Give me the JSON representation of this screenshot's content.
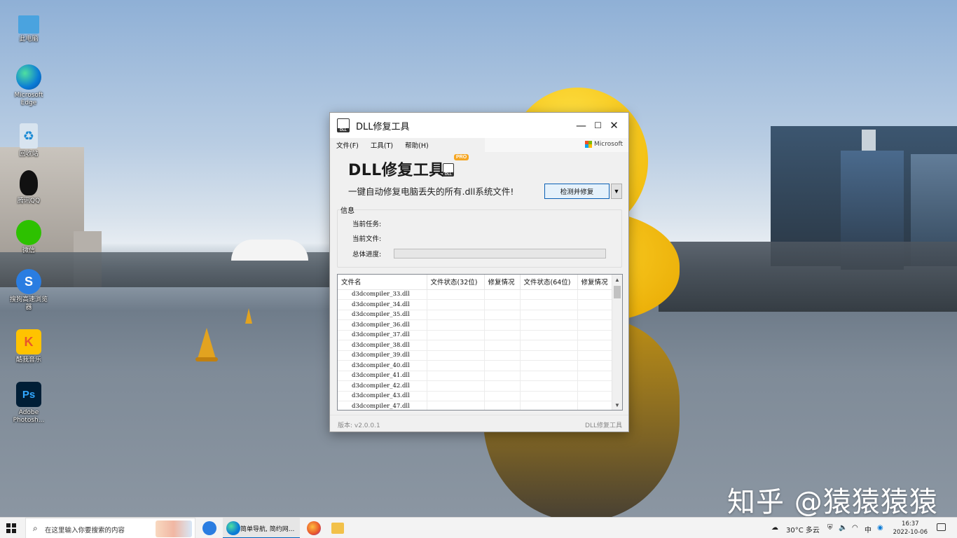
{
  "desktop": {
    "icons": [
      {
        "label": "此电脑",
        "icon": "computer-icon",
        "color": "#4aa3df"
      },
      {
        "label": "Microsoft Edge",
        "icon": "edge-icon",
        "color": "#0a7bd6"
      },
      {
        "label": "回收站",
        "icon": "recycle-bin-icon",
        "color": "#d8e4ef"
      },
      {
        "label": "腾讯QQ",
        "icon": "qq-icon",
        "color": "#111111"
      },
      {
        "label": "微信",
        "icon": "wechat-icon",
        "color": "#2dc100"
      },
      {
        "label": "搜狗高速浏览器",
        "icon": "sogou-browser-icon",
        "color": "#2a7de1"
      },
      {
        "label": "酷我音乐",
        "icon": "kuwo-music-icon",
        "color": "#ffc300"
      },
      {
        "label": "Adobe Photosh...",
        "icon": "photoshop-icon",
        "color": "#001e36"
      }
    ],
    "watermark": "知乎 @猿猿猿猿"
  },
  "window": {
    "title": "DLL修复工具",
    "controls": {
      "minimize": "—",
      "maximize": "☐",
      "close": "✕"
    },
    "menu": [
      "文件(F)",
      "工具(T)",
      "帮助(H)"
    ],
    "ms_label": "Microsoft",
    "brand": "DLL修复工具",
    "pro_badge": "PRO",
    "tagline": "一键自动修复电脑丢失的所有.dll系统文件!",
    "fix_button": "检测并修复",
    "dropdown_arrow": "▼",
    "info": {
      "group_label": "信息",
      "current_task_label": "当前任务:",
      "current_file_label": "当前文件:",
      "progress_label": "总体进度:",
      "progress": 0
    },
    "table": {
      "columns": [
        "文件名",
        "文件状态(32位)",
        "修复情况",
        "文件状态(64位)",
        "修复情况"
      ],
      "rows": [
        "d3dcompiler_33.dll",
        "d3dcompiler_34.dll",
        "d3dcompiler_35.dll",
        "d3dcompiler_36.dll",
        "d3dcompiler_37.dll",
        "d3dcompiler_38.dll",
        "d3dcompiler_39.dll",
        "d3dcompiler_40.dll",
        "d3dcompiler_41.dll",
        "d3dcompiler_42.dll",
        "d3dcompiler_43.dll",
        "d3dcompiler_47.dll"
      ]
    },
    "status": {
      "version": "版本: v2.0.0.1",
      "app_name": "DLL修复工具"
    }
  },
  "taskbar": {
    "search_placeholder": "在这里输入你要搜索的内容",
    "active_app_label": "简单导航, 简约网...",
    "weather": "30°C 多云",
    "ime": "中",
    "time": "16:37",
    "date": "2022-10-06",
    "accent": "#0067c0"
  }
}
